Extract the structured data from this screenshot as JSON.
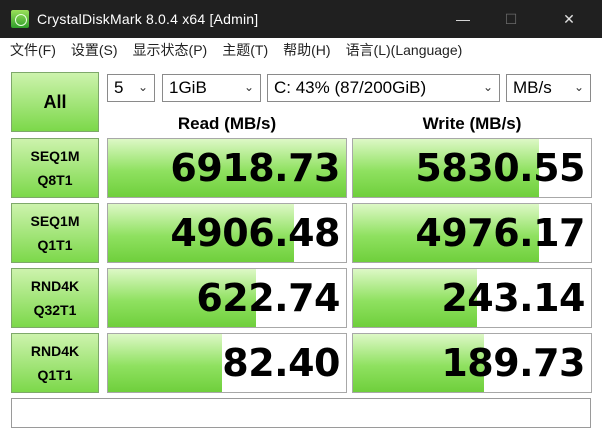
{
  "window": {
    "title": "CrystalDiskMark 8.0.4 x64 [Admin]",
    "minimize_glyph": "—",
    "maximize_glyph": "☐",
    "close_glyph": "✕"
  },
  "menu": [
    "文件(F)",
    "设置(S)",
    "显示状态(P)",
    "主题(T)",
    "帮助(H)",
    "语言(L)(Language)"
  ],
  "controls": {
    "all_label": "All",
    "count": "5",
    "size": "1GiB",
    "drive": "C: 43% (87/200GiB)",
    "unit": "MB/s",
    "chevron": "⌄"
  },
  "headers": {
    "read": "Read (MB/s)",
    "write": "Write (MB/s)"
  },
  "tests": [
    {
      "line1": "SEQ1M",
      "line2": "Q8T1",
      "read": "6918.73",
      "write": "5830.55",
      "read_level": 1.0,
      "write_level": 0.78
    },
    {
      "line1": "SEQ1M",
      "line2": "Q1T1",
      "read": "4906.48",
      "write": "4976.17",
      "read_level": 0.78,
      "write_level": 0.78
    },
    {
      "line1": "RND4K",
      "line2": "Q32T1",
      "read": "622.74",
      "write": "243.14",
      "read_level": 0.62,
      "write_level": 0.52
    },
    {
      "line1": "RND4K",
      "line2": "Q1T1",
      "read": "82.40",
      "write": "189.73",
      "read_level": 0.48,
      "write_level": 0.55
    }
  ],
  "comment": "",
  "colors": {
    "accent": "#7cd84a",
    "accent_light": "#cdf3ad",
    "titlebar": "#202020"
  }
}
